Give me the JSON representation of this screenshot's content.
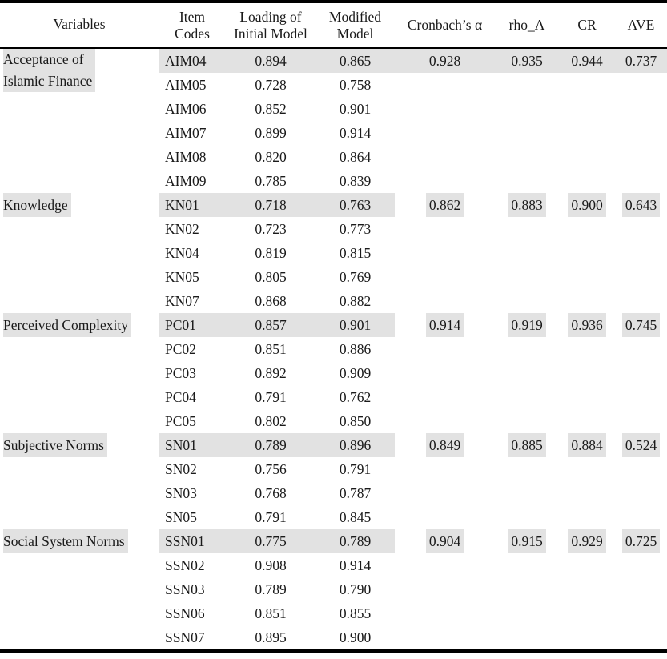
{
  "table": {
    "caption_present": false,
    "highlight_color": "#e2e2e2",
    "rule_color": "#000000",
    "columns": [
      {
        "key": "variables",
        "label": "Variables"
      },
      {
        "key": "item_codes",
        "label": "Item\nCodes"
      },
      {
        "key": "loading_initial",
        "label": "Loading of\nInitial Model"
      },
      {
        "key": "modified",
        "label": "Modified\nModel"
      },
      {
        "key": "cronbach",
        "label": "Cronbach’s α"
      },
      {
        "key": "rho_a",
        "label": "rho_A"
      },
      {
        "key": "cr",
        "label": "CR"
      },
      {
        "key": "ave",
        "label": "AVE"
      }
    ],
    "groups": [
      {
        "variable": "Acceptance of Islamic Finance",
        "variable_lines": [
          "Acceptance of",
          "Islamic Finance"
        ],
        "cronbach": "0.928",
        "rho_a": "0.935",
        "cr": "0.944",
        "ave": "0.737",
        "stat_band": "continuous",
        "items": [
          {
            "code": "AIM04",
            "loading_initial": "0.894",
            "modified": "0.865"
          },
          {
            "code": "AIM05",
            "loading_initial": "0.728",
            "modified": "0.758"
          },
          {
            "code": "AIM06",
            "loading_initial": "0.852",
            "modified": "0.901"
          },
          {
            "code": "AIM07",
            "loading_initial": "0.899",
            "modified": "0.914"
          },
          {
            "code": "AIM08",
            "loading_initial": "0.820",
            "modified": "0.864"
          },
          {
            "code": "AIM09",
            "loading_initial": "0.785",
            "modified": "0.839"
          }
        ]
      },
      {
        "variable": "Knowledge",
        "variable_lines": [
          "Knowledge"
        ],
        "cronbach": "0.862",
        "rho_a": "0.883",
        "cr": "0.900",
        "ave": "0.643",
        "stat_band": "chips",
        "items": [
          {
            "code": "KN01",
            "loading_initial": "0.718",
            "modified": "0.763"
          },
          {
            "code": "KN02",
            "loading_initial": "0.723",
            "modified": "0.773"
          },
          {
            "code": "KN04",
            "loading_initial": "0.819",
            "modified": "0.815"
          },
          {
            "code": "KN05",
            "loading_initial": "0.805",
            "modified": "0.769"
          },
          {
            "code": "KN07",
            "loading_initial": "0.868",
            "modified": "0.882"
          }
        ]
      },
      {
        "variable": "Perceived Complexity",
        "variable_lines": [
          "Perceived Complexity"
        ],
        "cronbach": "0.914",
        "rho_a": "0.919",
        "cr": "0.936",
        "ave": "0.745",
        "stat_band": "chips",
        "items": [
          {
            "code": "PC01",
            "loading_initial": "0.857",
            "modified": "0.901"
          },
          {
            "code": "PC02",
            "loading_initial": "0.851",
            "modified": "0.886"
          },
          {
            "code": "PC03",
            "loading_initial": "0.892",
            "modified": "0.909"
          },
          {
            "code": "PC04",
            "loading_initial": "0.791",
            "modified": "0.762"
          },
          {
            "code": "PC05",
            "loading_initial": "0.802",
            "modified": "0.850"
          }
        ]
      },
      {
        "variable": "Subjective Norms",
        "variable_lines": [
          "Subjective Norms"
        ],
        "cronbach": "0.849",
        "rho_a": "0.885",
        "cr": "0.884",
        "ave": "0.524",
        "stat_band": "chips",
        "items": [
          {
            "code": "SN01",
            "loading_initial": "0.789",
            "modified": "0.896"
          },
          {
            "code": "SN02",
            "loading_initial": "0.756",
            "modified": "0.791"
          },
          {
            "code": "SN03",
            "loading_initial": "0.768",
            "modified": "0.787"
          },
          {
            "code": "SN05",
            "loading_initial": "0.791",
            "modified": "0.845"
          }
        ]
      },
      {
        "variable": "Social System Norms",
        "variable_lines": [
          "Social System Norms"
        ],
        "cronbach": "0.904",
        "rho_a": "0.915",
        "cr": "0.929",
        "ave": "0.725",
        "stat_band": "chips",
        "items": [
          {
            "code": "SSN01",
            "loading_initial": "0.775",
            "modified": "0.789"
          },
          {
            "code": "SSN02",
            "loading_initial": "0.908",
            "modified": "0.914"
          },
          {
            "code": "SSN03",
            "loading_initial": "0.789",
            "modified": "0.790"
          },
          {
            "code": "SSN06",
            "loading_initial": "0.851",
            "modified": "0.855"
          },
          {
            "code": "SSN07",
            "loading_initial": "0.895",
            "modified": "0.900"
          }
        ]
      }
    ]
  }
}
